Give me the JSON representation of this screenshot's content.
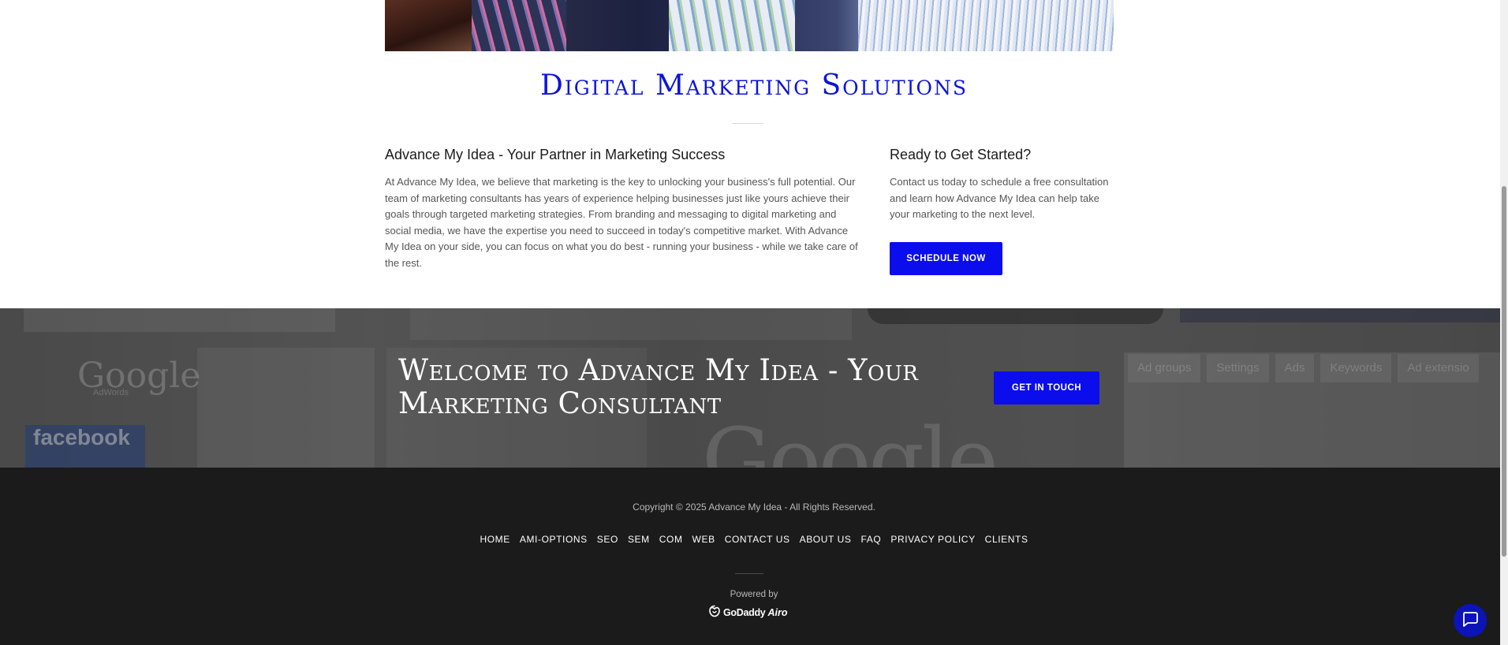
{
  "section": {
    "title": "Digital Marketing Solutions",
    "left": {
      "heading": "Advance My Idea - Your Partner in Marketing Success",
      "body": "At Advance My Idea, we believe that marketing is the key to unlocking your business's full potential. Our team of marketing consultants has years of experience helping businesses just like yours achieve their goals through targeted marketing strategies. From branding and messaging to digital marketing and social media, we have the expertise you need to succeed in today's competitive market. With Advance My Idea on your side, you can focus on what you do best - running your business - while we take care of the rest."
    },
    "right": {
      "heading": "Ready to Get Started?",
      "body": "Contact us today to schedule a free consultation and learn how Advance My Idea can help take your marketing to the next level.",
      "button": "SCHEDULE NOW"
    }
  },
  "banner": {
    "title": "Welcome to Advance My Idea - Your Marketing Consultant",
    "button": "GET IN TOUCH",
    "background_text": {
      "google_small": "Google",
      "google_small_sub": "AdWords",
      "facebook": "facebook",
      "google_big": "Google",
      "tabs": [
        "Ad groups",
        "Settings",
        "Ads",
        "Keywords",
        "Ad extensio"
      ]
    }
  },
  "footer": {
    "copyright": "Copyright © 2025 Advance My Idea - All Rights Reserved.",
    "nav": [
      "HOME",
      "AMI-OPTIONS",
      "SEO",
      "SEM",
      "COM",
      "WEB",
      "CONTACT US",
      "ABOUT US",
      "FAQ",
      "PRIVACY POLICY",
      "CLIENTS"
    ],
    "powered_by": "Powered by",
    "brand": "GoDaddy",
    "brand_suffix": "Airo"
  },
  "colors": {
    "accent": "#0b0ded",
    "title_blue": "#0b14dc",
    "footer_bg": "#1b1b1b"
  },
  "icons": {
    "chat": "chat-bubble-icon",
    "godaddy": "godaddy-logo-icon"
  }
}
